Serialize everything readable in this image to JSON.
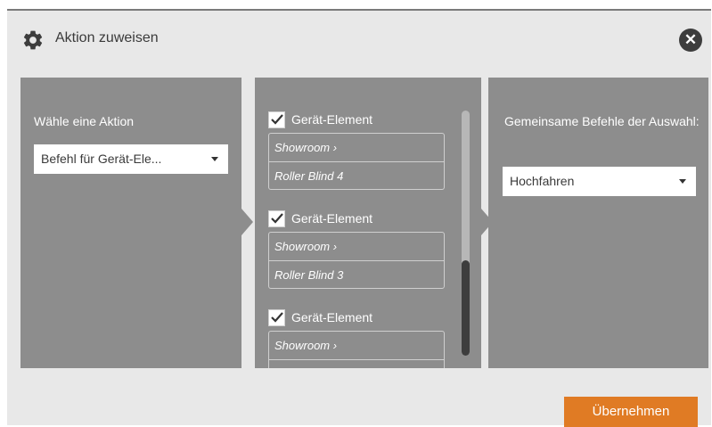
{
  "dialog": {
    "title": "Aktion zuweisen",
    "icon": "gear-icon",
    "close_icon": "close-icon",
    "accent_color": "#e07b24"
  },
  "action_panel": {
    "label": "Wähle eine Aktion",
    "selected": "Befehl für Gerät-Ele..."
  },
  "device_list": {
    "items": [
      {
        "checked": true,
        "label": "Gerät-Element",
        "room": "Showroom ›",
        "device": "Roller Blind 4"
      },
      {
        "checked": true,
        "label": "Gerät-Element",
        "room": "Showroom ›",
        "device": "Roller Blind 3"
      },
      {
        "checked": true,
        "label": "Gerät-Element",
        "room": "Showroom ›",
        "device": ""
      }
    ]
  },
  "command_panel": {
    "label": "Gemeinsame Befehle der Auswahl:",
    "selected": "Hochfahren"
  },
  "footer": {
    "apply_label": "Übernehmen"
  }
}
